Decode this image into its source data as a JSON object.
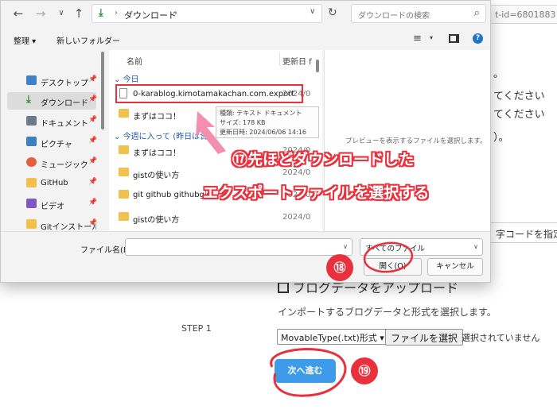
{
  "background_page": {
    "url_fragment": "t-id=6801883189",
    "lines": [
      "。",
      "てください",
      "てください",
      "）。"
    ],
    "select_fragment": "字コードを指定",
    "heading": "ブログデータをアップロード",
    "description": "インポートするブログデータと形式を選択します。",
    "step_label": "STEP 1",
    "format_select": "MovableType(.txt)形式",
    "file_button": "ファイルを選択",
    "file_status": "選択されていません",
    "next_button": "次へ進む"
  },
  "dialog": {
    "address": {
      "separator": "›",
      "folder": "ダウンロード",
      "trail": "›"
    },
    "search_placeholder": "ダウンロードの検索",
    "commands": {
      "organize": "整理 ▾",
      "new_folder": "新しいフォルダー"
    },
    "sidebar": [
      {
        "label": "デスクトップ",
        "icon": "desktop-icon",
        "color": "#3d82c9"
      },
      {
        "label": "ダウンロード",
        "icon": "download-icon",
        "color": "#2f8f3e",
        "selected": true
      },
      {
        "label": "ドキュメント",
        "icon": "document-icon",
        "color": "#6b7b8c"
      },
      {
        "label": "ピクチャ",
        "icon": "picture-icon",
        "color": "#3f7fbf"
      },
      {
        "label": "ミュージック",
        "icon": "music-icon",
        "color": "#e0613a"
      },
      {
        "label": "GitHub",
        "icon": "folder-icon",
        "color": "#f2c04b"
      },
      {
        "label": "ビデオ",
        "icon": "video-icon",
        "color": "#7e57c2"
      },
      {
        "label": "Gitインストール",
        "icon": "folder-icon",
        "color": "#f2c04b"
      }
    ],
    "columns": {
      "name": "名前",
      "date": "更新日 f"
    },
    "groups": {
      "today": "今日",
      "earlier": "今週に入って (昨日は含"
    },
    "files": [
      {
        "name": "0-karablog.kimotamakachan.com.export",
        "date": "2024/0",
        "icon": "document-icon"
      },
      {
        "name": "まずはココ！",
        "date": "",
        "icon": "folder-icon"
      },
      {
        "name": "まずはココ！",
        "date": "2024/0",
        "icon": "folder-icon"
      },
      {
        "name": "gistの使い方",
        "date": "2024/0",
        "icon": "folder-icon"
      },
      {
        "name": "git github githubgist",
        "date": "2024/0",
        "icon": "folder-icon"
      },
      {
        "name": "gistの使い方",
        "date": "2024/0",
        "icon": "folder-icon"
      }
    ],
    "tooltip": {
      "type": "種類: テキスト ドキュメント",
      "size": "サイズ: 178 KB",
      "modified": "更新日時: 2024/06/06 14:16"
    },
    "preview_message": "プレビューを表示するファイルを選択します。",
    "filename_label": "ファイル名(N):",
    "filename_value": "",
    "filetype": "すべてのファイル",
    "open_button": "開く(O)",
    "cancel_button": "キャンセル"
  },
  "annotations": {
    "step17_line1": "⑰先ほどダウンロードした",
    "step17_line2": "エクスポートファイルを選択する",
    "step18": "⑱",
    "step19": "⑲"
  }
}
